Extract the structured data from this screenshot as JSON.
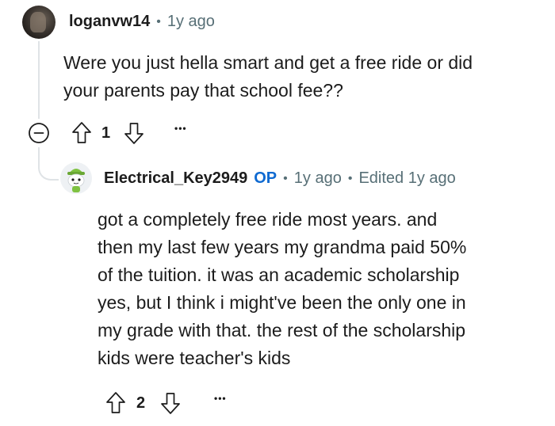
{
  "comment": {
    "username": "loganvw14",
    "separator": "•",
    "time": "1y ago",
    "body_lines": [
      "Were you just hella smart and get a free ride or did",
      "your parents pay that school fee??"
    ],
    "votes": "1",
    "more": "•••"
  },
  "reply": {
    "username": "Electrical_Key2949",
    "op_badge": "OP",
    "separator": "•",
    "time": "1y ago",
    "edited": "Edited 1y ago",
    "body_lines": [
      "got a completely free ride most years. and",
      "then my last few years my grandma paid 50%",
      "of the tuition. it was an academic scholarship",
      "yes, but I think i might've been the only one in",
      "my grade with that. the rest of the scholarship",
      "kids were teacher's kids"
    ],
    "votes": "2",
    "more": "•••"
  },
  "icons": {
    "collapse": "minus-circle-icon",
    "upvote": "arrow-up-outline-icon",
    "downvote": "arrow-down-outline-icon",
    "more": "ellipsis-icon"
  },
  "colors": {
    "text": "#1c1c1c",
    "meta": "#576f76",
    "op": "#0f6ad1",
    "thread": "#dfe3e6"
  }
}
